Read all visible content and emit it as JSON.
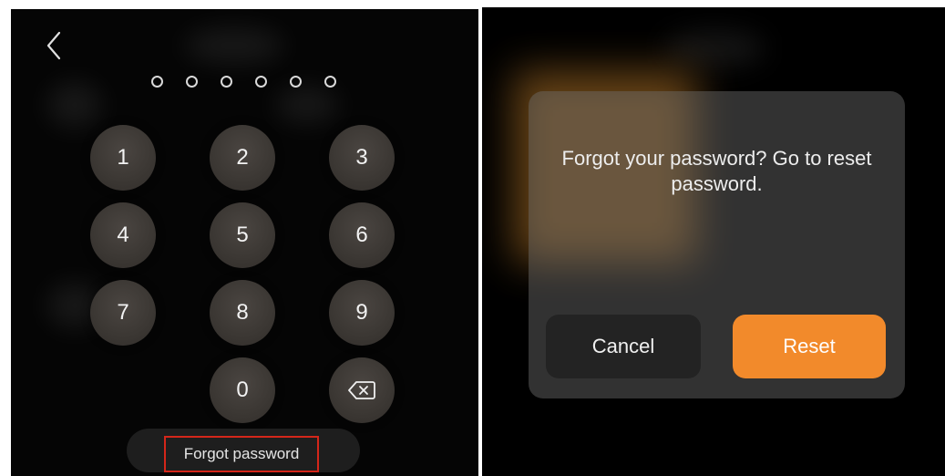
{
  "passcode_screen": {
    "back_icon": "chevron-left-icon",
    "passcode_length": 6,
    "keys": [
      "1",
      "2",
      "3",
      "4",
      "5",
      "6",
      "7",
      "8",
      "9",
      "0"
    ],
    "delete_icon": "backspace-icon",
    "forgot_password_label": "Forgot password"
  },
  "reset_dialog": {
    "message": "Forgot your password? Go to reset password.",
    "cancel_label": "Cancel",
    "reset_label": "Reset"
  },
  "colors": {
    "background": "#000000",
    "key_fill": "#3b3733",
    "highlight_border": "#d4261a",
    "reset_accent": "#f28a2b",
    "cancel_fill": "#232323"
  }
}
